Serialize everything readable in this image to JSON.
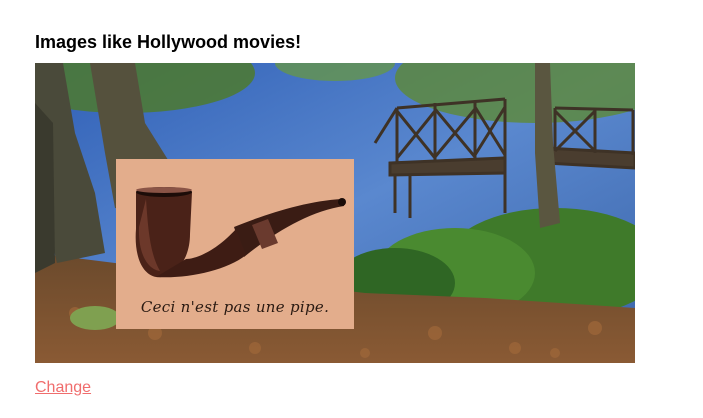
{
  "page": {
    "heading": "Images like Hollywood movies!",
    "link": {
      "label": "Change"
    }
  },
  "image": {
    "caption": "Ceci n'est pas une pipe."
  },
  "colors": {
    "link": "#f06d6d",
    "poster_background": "#e3ad8c",
    "heading": "#000000"
  }
}
